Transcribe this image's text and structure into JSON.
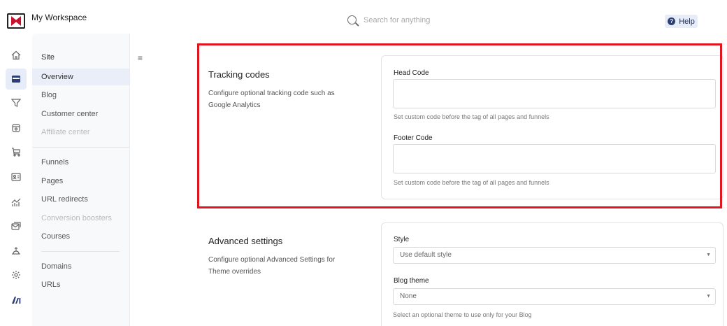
{
  "app": {
    "workspace_name": "My Workspace"
  },
  "search": {
    "placeholder": "Search for anything"
  },
  "help": {
    "label": "Help"
  },
  "rail": {
    "icons": [
      "home-icon",
      "website-icon",
      "funnel-icon",
      "store-icon",
      "cart-icon",
      "contacts-icon",
      "analytics-icon",
      "email-icon",
      "automation-icon",
      "settings-icon",
      "ai-icon"
    ],
    "active": "website-icon"
  },
  "sidebar": {
    "title": "Site",
    "items": [
      {
        "label": "Overview"
      },
      {
        "label": "Blog"
      },
      {
        "label": "Customer center"
      },
      {
        "label": "Affiliate center"
      },
      {
        "label": "Funnels"
      },
      {
        "label": "Pages"
      },
      {
        "label": "URL redirects"
      },
      {
        "label": "Conversion boosters"
      },
      {
        "label": "Courses"
      },
      {
        "label": "Domains"
      },
      {
        "label": "URLs"
      }
    ]
  },
  "tracking": {
    "title": "Tracking codes",
    "description": "Configure optional tracking code such as Google Analytics",
    "head_label": "Head Code",
    "head_value": "",
    "head_help": "Set custom code before the tag of all pages and funnels",
    "footer_label": "Footer Code",
    "footer_value": "",
    "footer_help": "Set custom code before the tag of all pages and funnels"
  },
  "advanced": {
    "title": "Advanced settings",
    "description": "Configure optional Advanced Settings for Theme overrides",
    "style_label": "Style",
    "style_value": "Use default style",
    "blog_theme_label": "Blog theme",
    "blog_theme_value": "None",
    "blog_theme_help": "Select an optional theme to use only for your Blog"
  },
  "colors": {
    "accent": "#2b3e78",
    "highlight": "#e0151f",
    "active_bg": "#e6ecf8"
  }
}
